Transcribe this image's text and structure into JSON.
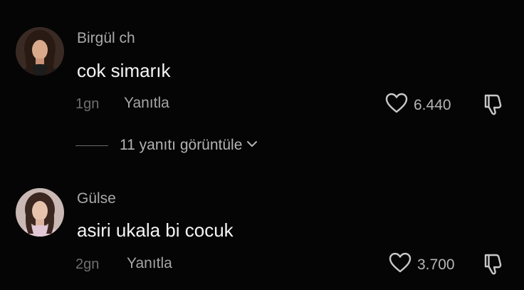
{
  "comments": [
    {
      "username": "Birgül ch",
      "text": "cok simarık",
      "time": "1gn",
      "reply_label": "Yanıtla",
      "like_count": "6.440"
    },
    {
      "username": "Gülse",
      "text": "asiri ukala bi cocuk",
      "time": "2gn",
      "reply_label": "Yanıtla",
      "like_count": "3.700"
    }
  ],
  "view_replies_label": "11 yanıtı görüntüle",
  "icons": {
    "like": "heart-outline-icon",
    "dislike": "thumbs-down-icon",
    "expand": "chevron-down-icon"
  },
  "colors": {
    "background": "#050505",
    "username": "#a9a9a9",
    "comment_text": "#f4f4f4",
    "meta": "#6e6e6e"
  }
}
